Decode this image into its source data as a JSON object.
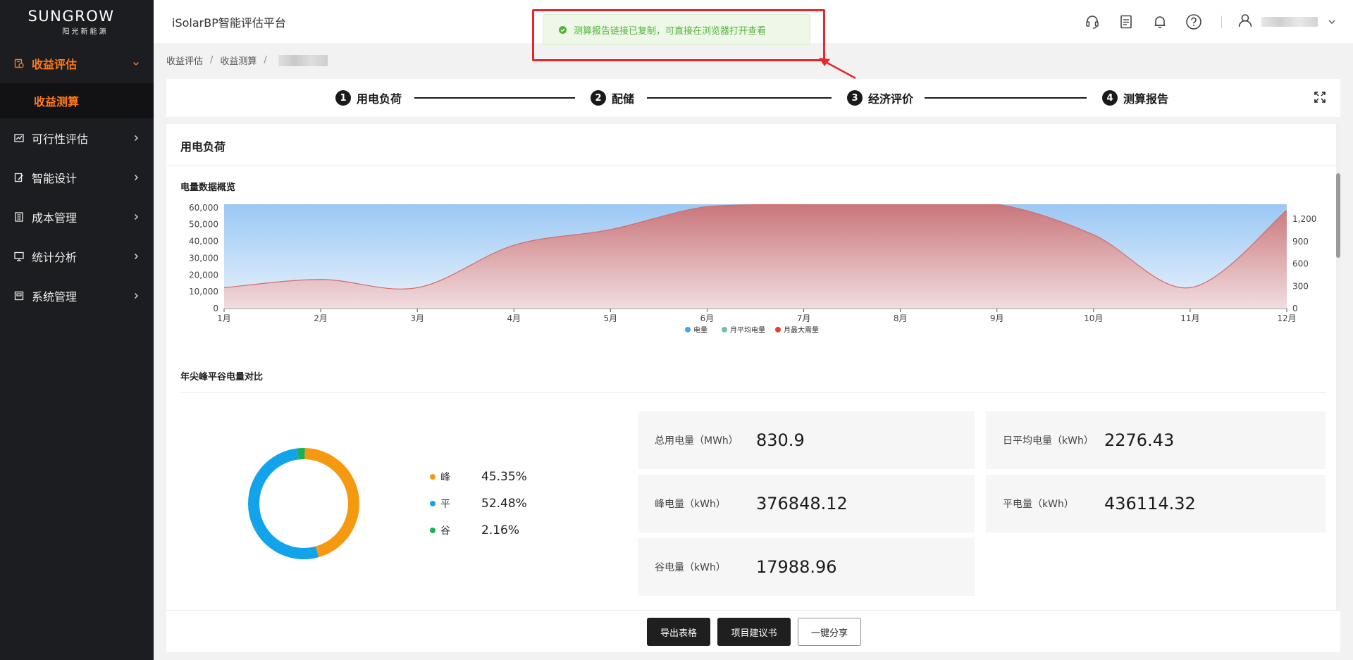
{
  "logo": {
    "main": "SUNGROW",
    "sub": "阳光新能源"
  },
  "sidebar": {
    "items": [
      {
        "label": "收益评估",
        "icon": "calculator-icon",
        "active": true,
        "expanded": true
      },
      {
        "label": "可行性评估",
        "icon": "chart-icon"
      },
      {
        "label": "智能设计",
        "icon": "edit-icon"
      },
      {
        "label": "成本管理",
        "icon": "ledger-icon"
      },
      {
        "label": "统计分析",
        "icon": "monitor-icon"
      },
      {
        "label": "系统管理",
        "icon": "settings-doc-icon"
      }
    ],
    "submenu": {
      "label": "收益测算"
    }
  },
  "header": {
    "title": "iSolarBP智能评估平台",
    "icons": [
      "headset-icon",
      "document-icon",
      "bell-icon",
      "help-icon",
      "user-icon"
    ]
  },
  "toast": {
    "message": "测算报告链接已复制，可直接在浏览器打开查看",
    "color": "#52b33a"
  },
  "breadcrumb": {
    "items": [
      "收益评估",
      "收益测算"
    ],
    "sep": "/"
  },
  "steps": [
    {
      "num": "1",
      "label": "用电负荷"
    },
    {
      "num": "2",
      "label": "配储"
    },
    {
      "num": "3",
      "label": "经济评价"
    },
    {
      "num": "4",
      "label": "测算报告"
    }
  ],
  "card": {
    "title": "用电负荷",
    "overview_title": "电量数据概览",
    "compare_title": "年尖峰平谷电量对比"
  },
  "chart_data": {
    "type": "area",
    "categories": [
      "1月",
      "2月",
      "3月",
      "4月",
      "5月",
      "6月",
      "7月",
      "8月",
      "9月",
      "10月",
      "11月",
      "12月"
    ],
    "y_left": {
      "ticks": [
        "0",
        "10,000",
        "20,000",
        "30,000",
        "40,000",
        "50,000",
        "60,000"
      ],
      "min": 0,
      "max": 62000
    },
    "y_right": {
      "ticks": [
        "0",
        "300",
        "600",
        "900",
        "1,200"
      ],
      "min": 0,
      "max": 1400
    },
    "series": [
      {
        "name": "电量",
        "color": "#4aa3ef",
        "axis": "left",
        "values": [
          62000,
          62000,
          62000,
          62000,
          62000,
          62000,
          62000,
          62000,
          62000,
          62000,
          62000,
          62000
        ]
      },
      {
        "name": "月平均电量",
        "color": "#6cc3a8",
        "axis": "left",
        "values": []
      },
      {
        "name": "月最大需量",
        "color": "#e8412c",
        "axis": "right",
        "values": [
          280,
          390,
          280,
          850,
          1060,
          1370,
          1500,
          1500,
          1420,
          990,
          280,
          1320
        ]
      }
    ],
    "legend_position": "bottom-center",
    "grid": true
  },
  "donut_data": {
    "type": "pie",
    "slices": [
      {
        "name": "峰",
        "pct": "45.35%",
        "value": 45.35,
        "color": "#f59a10"
      },
      {
        "name": "平",
        "pct": "52.48%",
        "value": 52.48,
        "color": "#13a3ea"
      },
      {
        "name": "谷",
        "pct": "2.16%",
        "value": 2.16,
        "color": "#18b157"
      }
    ]
  },
  "stats": [
    {
      "label": "总用电量（MWh）",
      "value": "830.9"
    },
    {
      "label": "日平均电量（kWh）",
      "value": "2276.43"
    },
    {
      "label": "峰电量（kWh）",
      "value": "376848.12"
    },
    {
      "label": "平电量（kWh）",
      "value": "436114.32"
    },
    {
      "label": "谷电量（kWh）",
      "value": "17988.96"
    }
  ],
  "footer": {
    "buttons": [
      {
        "label": "导出表格"
      },
      {
        "label": "项目建议书"
      },
      {
        "label": "一键分享"
      }
    ]
  }
}
